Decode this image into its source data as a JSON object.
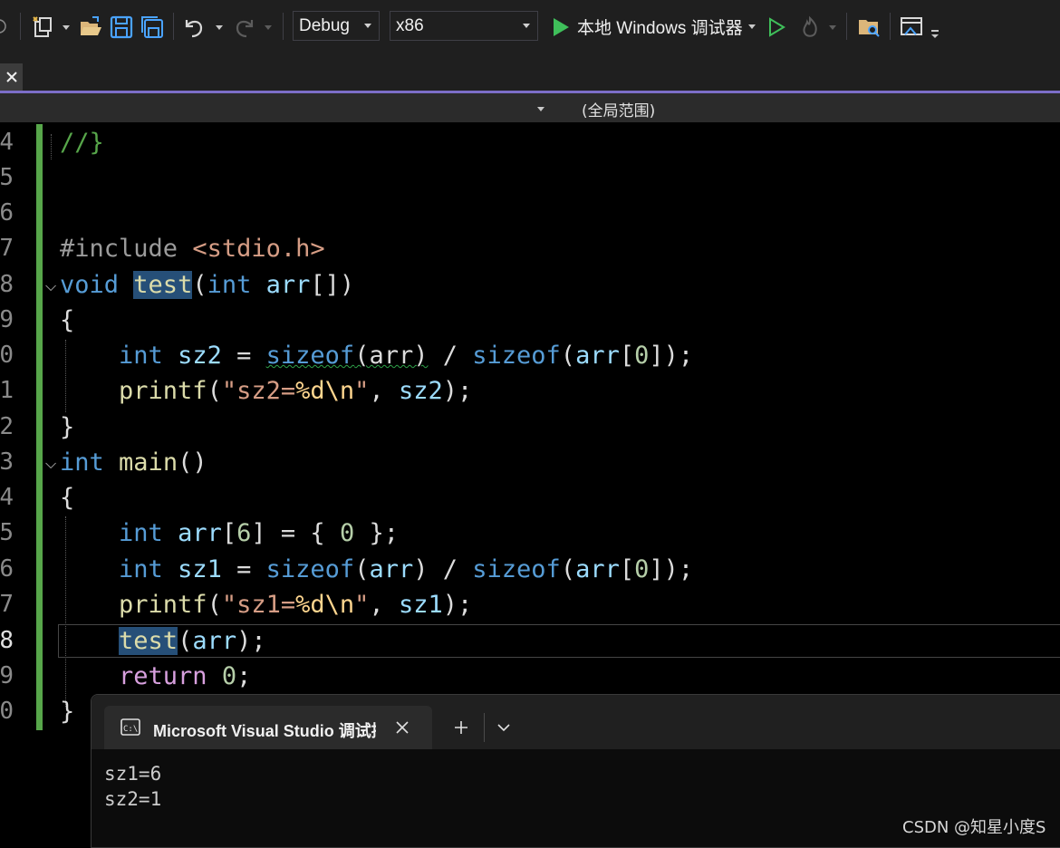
{
  "toolbar": {
    "config_value": "Debug",
    "platform_value": "x86",
    "debugger_label": "本地 Windows 调试器"
  },
  "navbar": {
    "scope": "(全局范围)"
  },
  "editor": {
    "line_numbers": [
      "4",
      "5",
      "6",
      "7",
      "8",
      "9",
      "0",
      "1",
      "2",
      "3",
      "4",
      "5",
      "6",
      "7",
      "8",
      "9",
      "0"
    ],
    "current_line_index": 14
  },
  "console": {
    "title": "Microsoft Visual Studio 调试控制台",
    "output": [
      "sz1=6",
      "sz2=1"
    ]
  },
  "watermark": "CSDN @知星小度S"
}
